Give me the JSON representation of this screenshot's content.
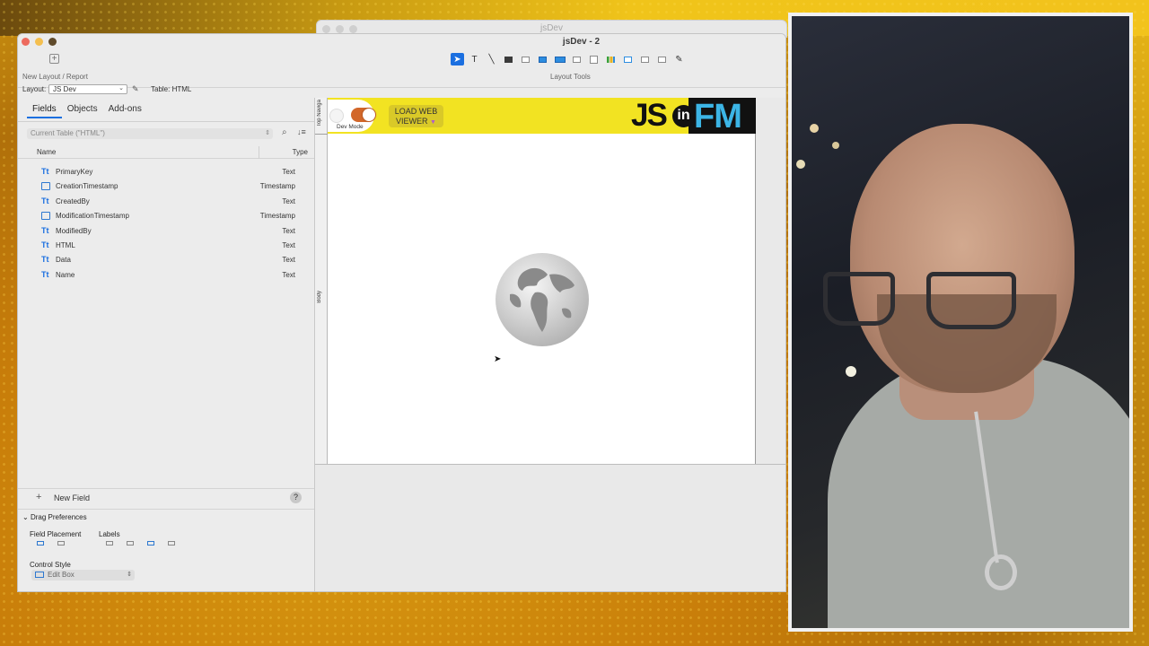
{
  "back_window": {
    "title": "jsDev"
  },
  "window": {
    "title": "jsDev - 2",
    "new_layout_label": "New Layout / Report",
    "layout_tools_label": "Layout Tools",
    "layout_label": "Layout:",
    "layout_value": "JS Dev",
    "table_label": "Table: HTML"
  },
  "tools": [
    {
      "name": "pointer-tool",
      "glyph": "➤"
    },
    {
      "name": "text-tool",
      "glyph": "T"
    },
    {
      "name": "line-tool",
      "glyph": "╲"
    },
    {
      "name": "rectangle-tool",
      "glyph": "■"
    },
    {
      "name": "field-tool",
      "glyph": ""
    },
    {
      "name": "button-tool",
      "glyph": ""
    },
    {
      "name": "button-bar-tool",
      "glyph": ""
    },
    {
      "name": "popover-tool",
      "glyph": ""
    },
    {
      "name": "portal-tool",
      "glyph": ""
    },
    {
      "name": "chart-tool",
      "glyph": ""
    },
    {
      "name": "web-viewer-tool",
      "glyph": ""
    },
    {
      "name": "slide-control-tool",
      "glyph": ""
    },
    {
      "name": "tab-control-tool",
      "glyph": ""
    },
    {
      "name": "format-painter-tool",
      "glyph": "✎"
    }
  ],
  "left_pane": {
    "tabs": [
      "Fields",
      "Objects",
      "Add-ons"
    ],
    "table_picker": "Current Table (\"HTML\")",
    "col_name": "Name",
    "col_type": "Type",
    "fields": [
      {
        "name": "PrimaryKey",
        "type": "Text",
        "kind": "text"
      },
      {
        "name": "CreationTimestamp",
        "type": "Timestamp",
        "kind": "timestamp"
      },
      {
        "name": "CreatedBy",
        "type": "Text",
        "kind": "text"
      },
      {
        "name": "ModificationTimestamp",
        "type": "Timestamp",
        "kind": "timestamp"
      },
      {
        "name": "ModifiedBy",
        "type": "Text",
        "kind": "text"
      },
      {
        "name": "HTML",
        "type": "Text",
        "kind": "text"
      },
      {
        "name": "Data",
        "type": "Text",
        "kind": "text"
      },
      {
        "name": "Name",
        "type": "Text",
        "kind": "text"
      }
    ],
    "text_icon_glyph": "Tt",
    "new_field": "New Field",
    "help": "?",
    "drag_preferences": "Drag Preferences",
    "field_placement": "Field Placement",
    "labels": "Labels",
    "control_style": "Control Style",
    "control_style_value": "Edit Box"
  },
  "canvas": {
    "part_nav": "Top Naviga",
    "part_body": "Body",
    "dev_mode": "Dev Mode",
    "load_button_line1": "LOAD WEB",
    "load_button_line2": "VIEWER",
    "logo_js": "JS",
    "logo_in": "in",
    "logo_fm": "FM"
  },
  "colors": {
    "accent": "#1b6fe0",
    "nav_yellow": "#f2e322",
    "toggle_orange": "#d2672a",
    "logo_blue": "#3cb5e6"
  }
}
